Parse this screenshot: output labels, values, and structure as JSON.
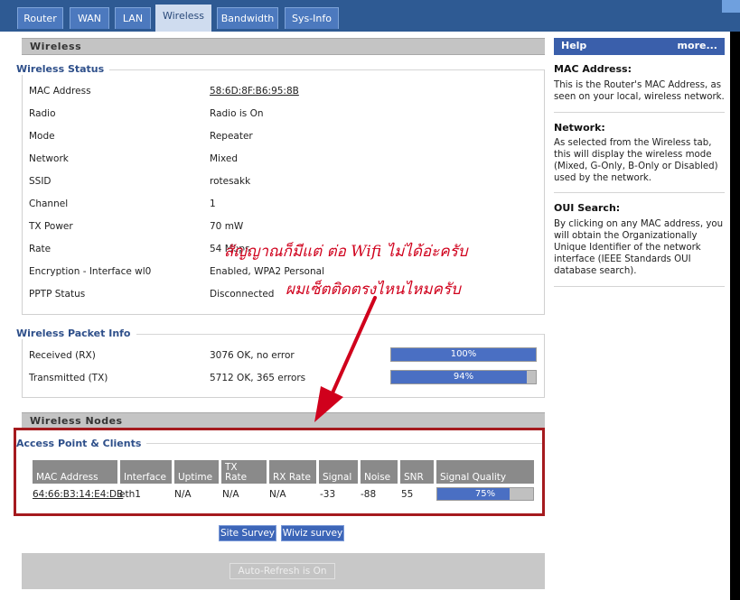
{
  "tabs": [
    "Router",
    "WAN",
    "LAN",
    "Wireless",
    "Bandwidth",
    "Sys-Info"
  ],
  "active_tab": "Wireless",
  "wireless_section": {
    "title": "Wireless",
    "status_legend": "Wireless Status",
    "rows": [
      {
        "label": "MAC Address",
        "value": "58:6D:8F:B6:95:8B"
      },
      {
        "label": "Radio",
        "value": "Radio is On"
      },
      {
        "label": "Mode",
        "value": "Repeater"
      },
      {
        "label": "Network",
        "value": "Mixed"
      },
      {
        "label": "SSID",
        "value": "rotesakk"
      },
      {
        "label": "Channel",
        "value": "1"
      },
      {
        "label": "TX Power",
        "value": "70 mW"
      },
      {
        "label": "Rate",
        "value": "54 Mbps"
      },
      {
        "label": "Encryption - Interface wl0",
        "value": "Enabled, WPA2 Personal"
      },
      {
        "label": "PPTP Status",
        "value": "Disconnected"
      }
    ]
  },
  "packet_info": {
    "legend": "Wireless Packet Info",
    "rows": [
      {
        "label": "Received (RX)",
        "value": "3076 OK, no error",
        "meter_text": "100%",
        "meter_fraction": 1.0
      },
      {
        "label": "Transmitted (TX)",
        "value": "5712 OK, 365 errors",
        "meter_text": "94%",
        "meter_fraction": 0.94
      }
    ]
  },
  "nodes": {
    "title": "Wireless Nodes",
    "legend": "Access Point & Clients",
    "headers": [
      "MAC Address",
      "Interface",
      "Uptime",
      "TX Rate",
      "RX Rate",
      "Signal",
      "Noise",
      "SNR",
      "Signal Quality"
    ],
    "row": {
      "mac": "64:66:B3:14:E4:DB",
      "interface": "eth1",
      "uptime": "N/A",
      "tx_rate": "N/A",
      "rx_rate": "N/A",
      "signal": "-33",
      "noise": "-88",
      "snr": "55",
      "quality_text": "75%",
      "quality_fraction": 0.75
    }
  },
  "buttons": {
    "site_survey": "Site Survey",
    "wiviz": "Wiviz survey",
    "auto_refresh": "Auto-Refresh is On"
  },
  "help": {
    "title": "Help",
    "more": "more...",
    "items": [
      {
        "title": "MAC Address:",
        "text": "This is the Router's MAC Address, as seen on your local, wireless network."
      },
      {
        "title": "Network:",
        "text": "As selected from the Wireless tab, this will display the wireless mode (Mixed, G-Only, B-Only or Disabled) used by the network."
      },
      {
        "title": "OUI Search:",
        "text": "By clicking on any MAC address, you will obtain the Organizationally Unique Identifier of the network interface (IEEE Standards OUI database search)."
      }
    ]
  },
  "annotation": {
    "line1": "สัญญาณก็มีแต่ ต่อ Wifi ไม่ได้อ่ะครับ",
    "line2": "ผมเซ็ตติดตรงไหนไหมครับ",
    "color": "#d0001c"
  }
}
